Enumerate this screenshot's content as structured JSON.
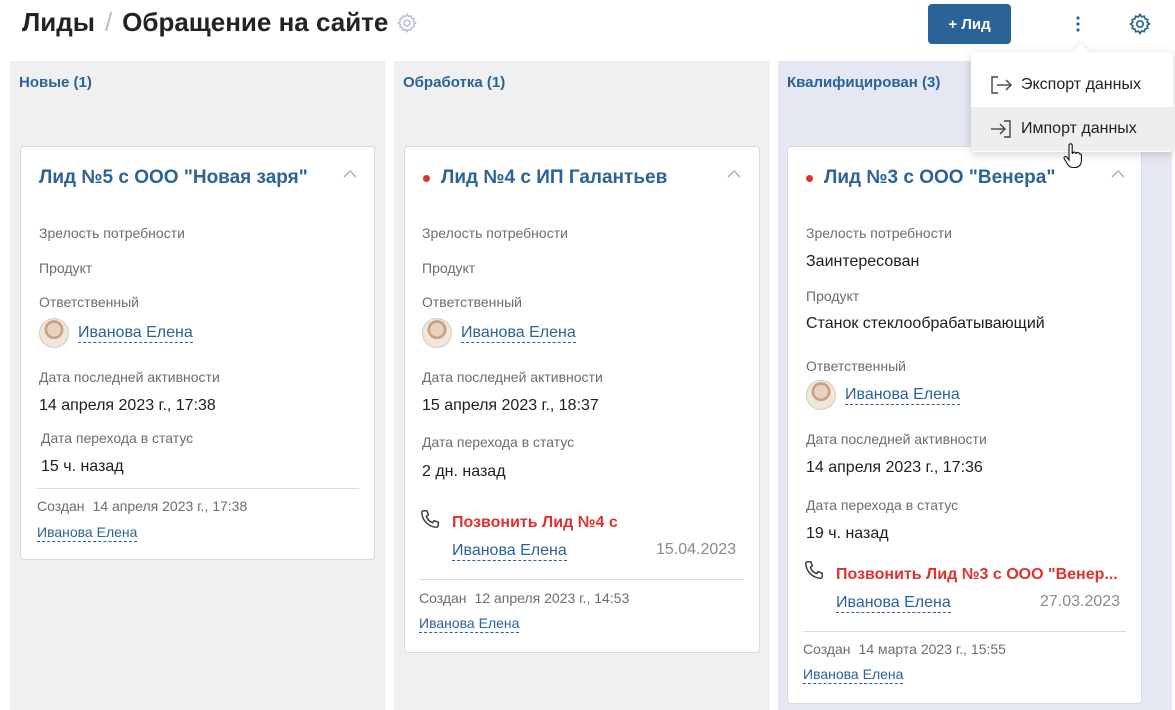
{
  "header": {
    "title_main": "Лиды",
    "separator": "/",
    "title_sub": "Обращение на сайте",
    "add_button": "+ Лид"
  },
  "menu": {
    "items": [
      {
        "label": "Экспорт данных",
        "icon": "export-icon"
      },
      {
        "label": "Импорт данных",
        "icon": "import-icon"
      }
    ]
  },
  "labels": {
    "maturity": "Зрелость потребности",
    "product": "Продукт",
    "responsible": "Ответственный",
    "last_activity": "Дата последней активности",
    "status_change": "Дата перехода в статус",
    "created": "Создан"
  },
  "columns": [
    {
      "title": "Новые (1)",
      "card": {
        "title": "Лид №5 с ООО \"Новая заря\"",
        "responsible": "Иванова Елена",
        "last_activity": "14 апреля 2023 г., 17:38",
        "status_change": "15 ч. назад",
        "created_date": "14 апреля 2023 г., 17:38",
        "creator": "Иванова Елена"
      }
    },
    {
      "title": "Обработка (1)",
      "card": {
        "title": "Лид №4 с ИП Галантьев",
        "responsible": "Иванова Елена",
        "last_activity": "15 апреля 2023 г., 18:37",
        "status_change": "2 дн. назад",
        "task_title": "Позвонить Лид №4 с",
        "task_person": "Иванова Елена",
        "task_date": "15.04.2023",
        "created_date": "12 апреля 2023 г., 14:53",
        "creator": "Иванова Елена"
      }
    },
    {
      "title": "Квалифицирован (3)",
      "card": {
        "title": "Лид №3 с ООО \"Венера\"",
        "maturity": "Заинтересован",
        "product": "Станок стеклообрабатывающий",
        "responsible": "Иванова Елена",
        "last_activity": "14 апреля 2023 г., 17:36",
        "status_change": "19 ч. назад",
        "task_title": "Позвонить Лид №3 с ООО \"Венер...",
        "task_person": "Иванова Елена",
        "task_date": "27.03.2023",
        "created_date": "14 марта 2023 г., 15:55",
        "creator": "Иванова Елена"
      }
    }
  ],
  "colors": {
    "accent": "#2a6397",
    "alert": "#e0312d",
    "qualified_bg": "#e5e7f3"
  }
}
